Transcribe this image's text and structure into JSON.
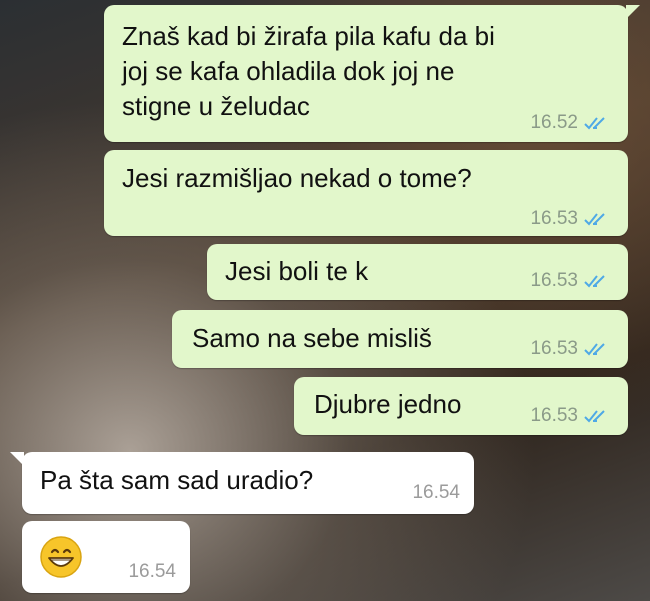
{
  "messages": [
    {
      "text": "Znaš kad bi žirafa pila kafu da bi\njoj se kafa ohladila dok joj ne\nstigne u želudac",
      "time": "16.52"
    },
    {
      "text": "Jesi razmišljao nekad o tome?",
      "time": "16.53"
    },
    {
      "text": "Jesi boli te k",
      "time": "16.53"
    },
    {
      "text": "Samo na sebe misliš",
      "time": "16.53"
    },
    {
      "text": "Djubre jedno",
      "time": "16.53"
    },
    {
      "text": "Pa šta sam sad uradio?",
      "time": "16.54"
    },
    {
      "emoji": "grinning-face",
      "time": "16.54"
    }
  ],
  "colors": {
    "outgoing_bubble": "#e2f7cb",
    "incoming_bubble": "#ffffff",
    "read_ticks": "#4fa9e6"
  }
}
